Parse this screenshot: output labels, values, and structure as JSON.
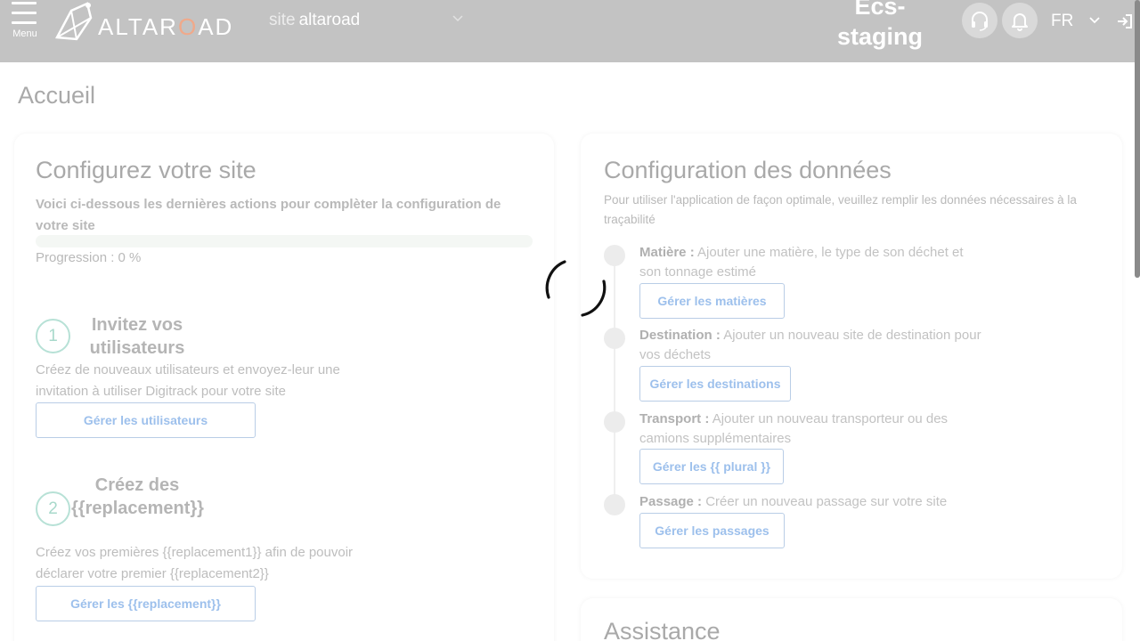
{
  "header": {
    "menu_label": "Menu",
    "logo_prefix": "ALTAR",
    "logo_o": "O",
    "logo_suffix": "AD",
    "site_prefix": "site",
    "site_name": "altaroad",
    "env_title": "Ecs-staging",
    "language": "FR"
  },
  "page": {
    "title": "Accueil"
  },
  "setup_card": {
    "title": "Configurez votre site",
    "subtitle": "Voici ci-dessous les dernières actions pour complèter la configuration de votre site",
    "progress_label": "Progression : 0 %",
    "progress_value": 0,
    "steps": [
      {
        "number": "1",
        "title": "Invitez vos utilisateurs",
        "description": "Créez de nouveaux utilisateurs et envoyez-leur une invitation à utiliser Digitrack pour votre site",
        "button": "Gérer les utilisateurs"
      },
      {
        "number": "2",
        "title": "Créez des {{replacement}}",
        "description": "Créez vos premières {{replacement1}} afin de pouvoir déclarer votre premier {{replacement2}}",
        "button": "Gérer les {{replacement}}"
      }
    ]
  },
  "data_card": {
    "title": "Configuration des données",
    "intro": "Pour utiliser l'application de façon optimale, veuillez remplir les données nécessaires à la traçabilité",
    "items": [
      {
        "label": "Matière :",
        "text": "Ajouter une matière, le type de son déchet et son tonnage estimé",
        "button": "Gérer les matières"
      },
      {
        "label": "Destination :",
        "text": "Ajouter un nouveau site de destination pour vos déchets",
        "button": "Gérer les destinations"
      },
      {
        "label": "Transport :",
        "text": "Ajouter un nouveau transporteur ou des camions supplémentaires",
        "button": "Gérer les {{ plural }}"
      },
      {
        "label": "Passage :",
        "text": "Créer un nouveau passage sur votre site",
        "button": "Gérer les passages"
      }
    ]
  },
  "assist_card": {
    "title": "Assistance"
  },
  "colors": {
    "header_bg": "#c3c3c3",
    "accent_teal": "#b7e1d6",
    "button_blue": "#9dc0ec",
    "logo_accent": "#f0a98a"
  },
  "icons": {
    "menu": "menu-icon",
    "logo": "altaroad-logo-icon",
    "support": "headset-icon",
    "notifications": "bell-icon",
    "lang_dropdown": "chevron-down-icon",
    "logout": "logout-icon",
    "loading": "loading-spinner-icon"
  }
}
